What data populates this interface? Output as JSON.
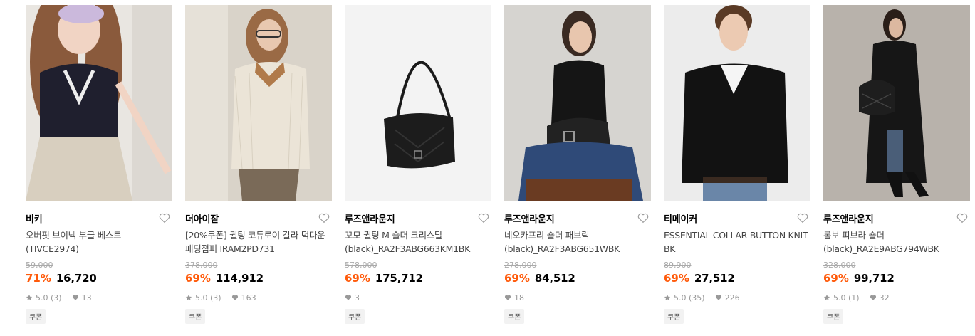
{
  "products": [
    {
      "brand": "비키",
      "title": "오버핏 브이넥 부클 베스트 (TIVCE2974)",
      "original_price": "59,000",
      "discount": "71%",
      "price": "16,720",
      "rating": "5.0 (3)",
      "likes": "13",
      "coupon": "쿠폰"
    },
    {
      "brand": "더아이잗",
      "title": "[20%쿠폰] 퀼팅 코듀로이 칼라 덕다운 패딩점퍼 IRAM2PD731",
      "original_price": "378,000",
      "discount": "69%",
      "price": "114,912",
      "rating": "5.0 (3)",
      "likes": "163",
      "coupon": "쿠폰"
    },
    {
      "brand": "루즈앤라운지",
      "title": "꼬모 퀼팅 M 숄더 크리스탈(black)_RA2F3ABG663KM1BK",
      "original_price": "578,000",
      "discount": "69%",
      "price": "175,712",
      "rating": "",
      "likes": "3",
      "coupon": "쿠폰"
    },
    {
      "brand": "루즈앤라운지",
      "title": "네오카프리 숄더 패브릭(black)_RA2F3ABG651WBK",
      "original_price": "278,000",
      "discount": "69%",
      "price": "84,512",
      "rating": "",
      "likes": "18",
      "coupon": "쿠폰"
    },
    {
      "brand": "티메이커",
      "title": "ESSENTIAL COLLAR BUTTON KNIT BK",
      "original_price": "89,900",
      "discount": "69%",
      "price": "27,512",
      "rating": "5.0 (35)",
      "likes": "226",
      "coupon": "쿠폰"
    },
    {
      "brand": "루즈앤라운지",
      "title": "롬보 피브라 숄더(black)_RA2E9ABG794WBK",
      "original_price": "328,000",
      "discount": "69%",
      "price": "99,712",
      "rating": "5.0 (1)",
      "likes": "32",
      "coupon": "쿠폰"
    }
  ],
  "colors": {
    "discount": "#ff5a0a",
    "meta": "#999999",
    "coupon_bg": "#f2f2f2"
  }
}
